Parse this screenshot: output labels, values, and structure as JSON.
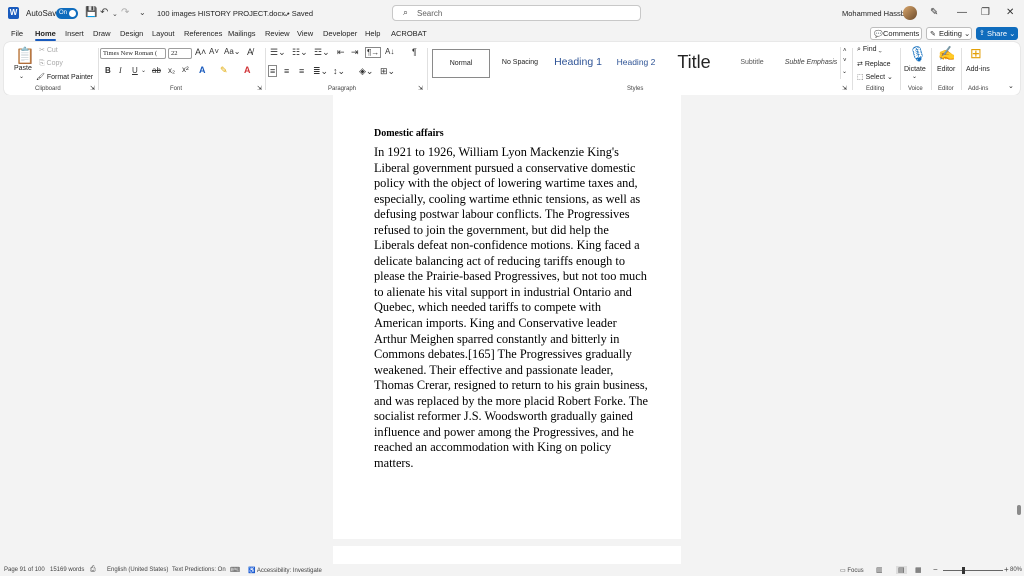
{
  "titlebar": {
    "autosave_label": "AutoSave",
    "autosave_state": "On",
    "document_title": "100 images HISTORY PROJECT.docx • Saved",
    "search_placeholder": "Search",
    "user_name": "Mohammed Hassbo"
  },
  "tabs": [
    "File",
    "Home",
    "Insert",
    "Draw",
    "Design",
    "Layout",
    "References",
    "Mailings",
    "Review",
    "View",
    "Developer",
    "Help",
    "ACROBAT"
  ],
  "active_tab": "Home",
  "actions": {
    "comments": "Comments",
    "editing": "Editing",
    "share": "Share"
  },
  "clipboard": {
    "paste": "Paste",
    "cut": "Cut",
    "copy": "Copy",
    "format_painter": "Format Painter",
    "label": "Clipboard"
  },
  "font": {
    "name": "Times New Roman (",
    "size": "22",
    "label": "Font"
  },
  "paragraph": {
    "label": "Paragraph"
  },
  "styles": {
    "label": "Styles",
    "items": [
      "Normal",
      "No Spacing",
      "Heading 1",
      "Heading 2",
      "Title",
      "Subtitle",
      "Subtle Emphasis"
    ]
  },
  "editing_group": {
    "find": "Find",
    "replace": "Replace",
    "select": "Select",
    "label": "Editing"
  },
  "voice": {
    "dictate": "Dictate",
    "label": "Voice"
  },
  "editor": {
    "editor": "Editor",
    "label": "Editor"
  },
  "addins": {
    "addins": "Add-ins",
    "label": "Add-ins"
  },
  "document": {
    "heading": "Domestic affairs",
    "body": "In 1921 to 1926, William Lyon Mackenzie King's Liberal government pursued a conservative domestic policy with the object of lowering wartime taxes and, especially, cooling wartime ethnic tensions, as well as defusing postwar labour conflicts. The Progressives refused to join the government, but did help the Liberals defeat non-confidence motions. King faced a delicate balancing act of reducing tariffs enough to please the Prairie-based Progressives, but not too much to alienate his vital support in industrial Ontario and Quebec, which needed tariffs to compete with American imports. King and Conservative leader Arthur Meighen sparred constantly and bitterly in Commons debates.[165] The Progressives gradually weakened. Their effective and passionate leader, Thomas Crerar, resigned to return to his grain business, and was replaced by the more placid Robert Forke. The socialist reformer J.S. Woodsworth gradually gained influence and power among the Progressives, and he reached an accommodation with King on policy matters."
  },
  "statusbar": {
    "page": "Page 91 of 100",
    "words": "15169 words",
    "language": "English (United States)",
    "predictions": "Text Predictions: On",
    "accessibility": "Accessibility: Investigate",
    "focus": "Focus",
    "zoom": "80%"
  },
  "colors": {
    "accent": "#0f6cbd",
    "word_brand": "#185abd"
  }
}
